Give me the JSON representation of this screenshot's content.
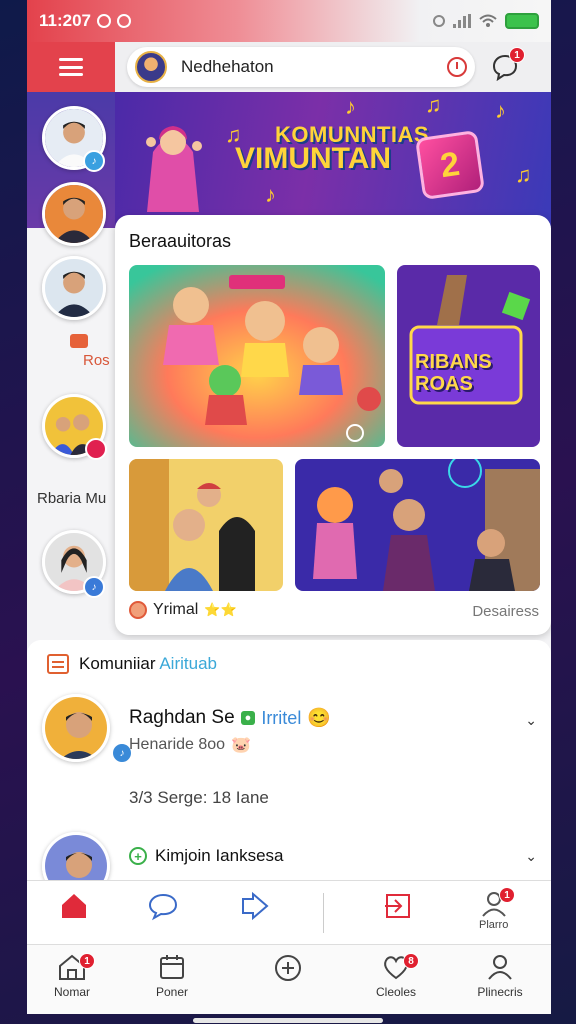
{
  "status_bar": {
    "time": "11:207",
    "accent": "#e3424c"
  },
  "header": {
    "menu_icon": "hamburger-icon",
    "search_text": "Nedhehaton",
    "chat_badge": "1"
  },
  "banner": {
    "line1": "KOMUNNTIAS",
    "line2": "VIMUNTAN",
    "cube_text": "2"
  },
  "rail": {
    "label_a": "Ros",
    "label_b": "Rbaria Mu"
  },
  "discover": {
    "title": "Beraauitoras",
    "thumb2_text": "RIBANS ROAS",
    "thumb1_sign": "",
    "footer_left": "Yrimal",
    "footer_stars": "⭐⭐",
    "footer_right": "Desairess"
  },
  "community": {
    "title_main": "Komuniiar",
    "title_accent": "Airituab",
    "post": {
      "name": "Raghdan Se",
      "tag": "●",
      "tag_text": "Irritel",
      "emoji": "😊",
      "sub": "Henaride 8oo",
      "sub_emoji": "🐷",
      "meta": "3/3 Serge: 18 Iane"
    },
    "post2_text": "Kimjoin Ianksesa"
  },
  "actionbar": {
    "profile_label": "Plarro",
    "profile_badge": "1"
  },
  "bottomnav": {
    "items": [
      {
        "label": "Nomar",
        "icon": "home-icon",
        "badge": "1"
      },
      {
        "label": "Poner",
        "icon": "calendar-icon"
      },
      {
        "label": "",
        "icon": "add-circle-icon"
      },
      {
        "label": "Cleoles",
        "icon": "heart-icon",
        "badge": "8"
      },
      {
        "label": "Plinecris",
        "icon": "person-icon"
      }
    ]
  }
}
